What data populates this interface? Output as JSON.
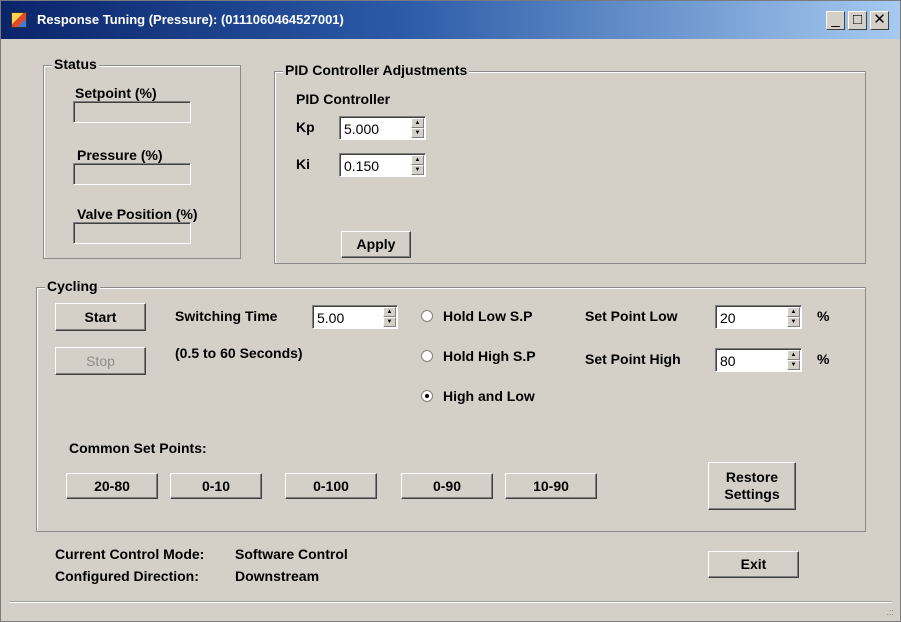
{
  "window": {
    "title": "Response Tuning (Pressure): (0111060464527001)",
    "min_glyph": "_",
    "max_glyph": "□",
    "close_glyph": "✕"
  },
  "status": {
    "title": "Status",
    "setpoint_label": "Setpoint (%)",
    "setpoint_value": "",
    "pressure_label": "Pressure (%)",
    "pressure_value": "",
    "valve_label": "Valve Position (%)",
    "valve_value": ""
  },
  "pid": {
    "title": "PID Controller Adjustments",
    "subtitle": "PID Controller",
    "kp_label": "Kp",
    "kp_value": "5.000",
    "ki_label": "Ki",
    "ki_value": "0.150",
    "apply_label": "Apply"
  },
  "cycling": {
    "title": "Cycling",
    "start_label": "Start",
    "stop_label": "Stop",
    "switching_time_label": "Switching Time",
    "switching_time_value": "5.00",
    "switching_range": "(0.5 to 60 Seconds)",
    "radios": [
      {
        "label": "Hold Low S.P",
        "checked": false
      },
      {
        "label": "Hold High S.P",
        "checked": false
      },
      {
        "label": "High and Low",
        "checked": true
      }
    ],
    "sp_low_label": "Set Point Low",
    "sp_low_value": "20",
    "sp_high_label": "Set Point High",
    "sp_high_value": "80",
    "percent": "%",
    "common_label": "Common Set Points:",
    "presets": [
      "20-80",
      "0-10",
      "0-100",
      "0-90",
      "10-90"
    ],
    "restore_label_1": "Restore",
    "restore_label_2": "Settings"
  },
  "footer": {
    "mode_label": "Current Control Mode:",
    "mode_value": "Software Control",
    "direction_label": "Configured Direction:",
    "direction_value": "Downstream",
    "exit_label": "Exit",
    "grip": ".::"
  },
  "colors": {
    "window_bg": "#d4d0c8",
    "titlebar_start": "#0a246a",
    "titlebar_end": "#a6caf0"
  }
}
